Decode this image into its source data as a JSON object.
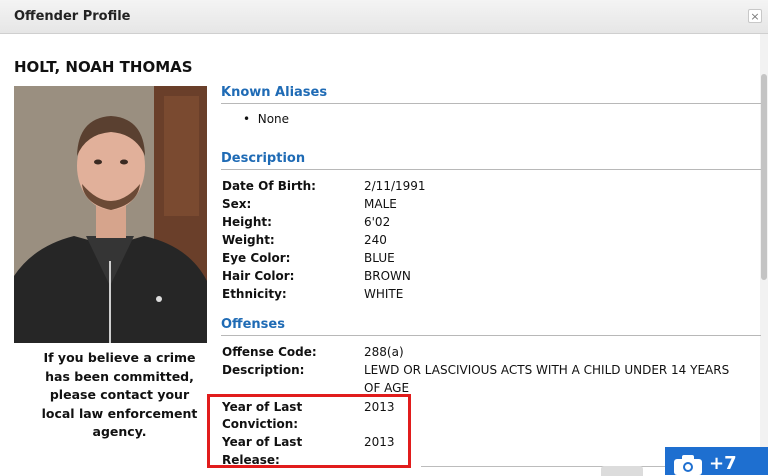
{
  "window": {
    "title": "Offender Profile",
    "close_glyph": "×"
  },
  "profile": {
    "name": "HOLT, NOAH THOMAS",
    "advisory_lines": [
      "If you believe a crime",
      "has been committed,",
      "please contact your",
      "local law enforcement",
      "agency."
    ]
  },
  "aliases": {
    "heading": "Known Aliases",
    "items": [
      "None"
    ]
  },
  "description": {
    "heading": "Description",
    "rows": [
      {
        "label": "Date Of Birth:",
        "value": "2/11/1991"
      },
      {
        "label": "Sex:",
        "value": "MALE"
      },
      {
        "label": "Height:",
        "value": "6'02"
      },
      {
        "label": "Weight:",
        "value": "240"
      },
      {
        "label": "Eye Color:",
        "value": "BLUE"
      },
      {
        "label": "Hair Color:",
        "value": "BROWN"
      },
      {
        "label": "Ethnicity:",
        "value": "WHITE"
      }
    ]
  },
  "offenses": {
    "heading": "Offenses",
    "code_label": "Offense Code:",
    "code_value": "288(a)",
    "desc_label": "Description:",
    "desc_value_line1": "LEWD OR LASCIVIOUS ACTS WITH A CHILD UNDER 14 YEARS",
    "desc_value_line2": "OF AGE",
    "conviction_label_line1": "Year of Last",
    "conviction_label_line2": "Conviction:",
    "conviction_value": "2013",
    "release_label_line1": "Year of Last",
    "release_label_line2": "Release:",
    "release_value": "2013"
  },
  "overlay": {
    "photo_count": "+7",
    "icon": "camera-icon"
  },
  "colors": {
    "section_heading": "#1f6bb5",
    "highlight_box": "#e11c1c",
    "photo_badge": "#1e6fd0"
  }
}
